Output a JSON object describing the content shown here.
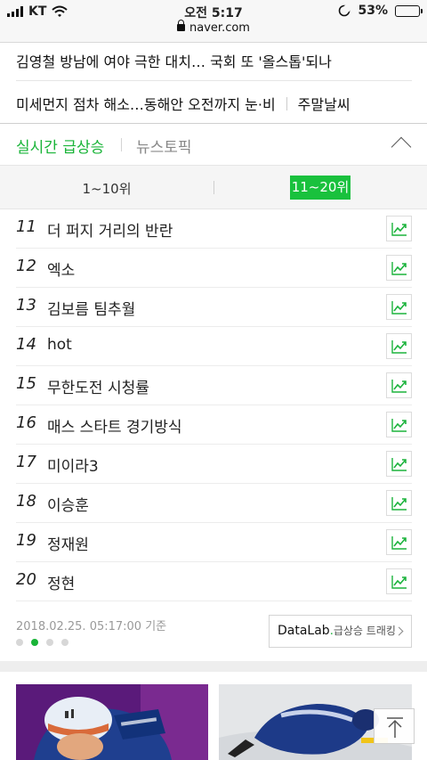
{
  "status_bar": {
    "carrier": "KT",
    "time": "오전 5:17",
    "url": "naver.com",
    "battery": "53%",
    "battery_level": 0.53,
    "icons": [
      "signal-icon",
      "wifi-icon",
      "lock-icon",
      "moon-icon",
      "battery-icon"
    ]
  },
  "news": {
    "headline1": "김영철 방남에 여야 극한 대치… 국회 또 '올스톱'되나",
    "headline2": "미세먼지 점차 해소…동해안 오전까지 눈·비",
    "headline2_extra": "주말날씨"
  },
  "tabs": {
    "realtime": "실시간 급상승",
    "news_topic": "뉴스토픽"
  },
  "ranges": {
    "left": "1~10위",
    "right": "11~20위",
    "selected": "11~20위"
  },
  "rankings": [
    {
      "rank": "11",
      "keyword": "더 퍼지 거리의 반란"
    },
    {
      "rank": "12",
      "keyword": "엑소"
    },
    {
      "rank": "13",
      "keyword": "김보름 팀추월"
    },
    {
      "rank": "14",
      "keyword": "hot"
    },
    {
      "rank": "15",
      "keyword": "무한도전 시청률"
    },
    {
      "rank": "16",
      "keyword": "매스 스타트 경기방식"
    },
    {
      "rank": "17",
      "keyword": "미이라3"
    },
    {
      "rank": "18",
      "keyword": "이승훈"
    },
    {
      "rank": "19",
      "keyword": "정재원"
    },
    {
      "rank": "20",
      "keyword": "정현"
    }
  ],
  "footer": {
    "timestamp": "2018.02.25. 05:17:00 기준",
    "datalab_brand": "DataLab",
    "datalab_dot": ".",
    "datalab_label": "급상승 트래킹",
    "page_count": 4,
    "active_page": 2
  },
  "colors": {
    "accent": "#19b438",
    "range_active": "#19c13d"
  }
}
